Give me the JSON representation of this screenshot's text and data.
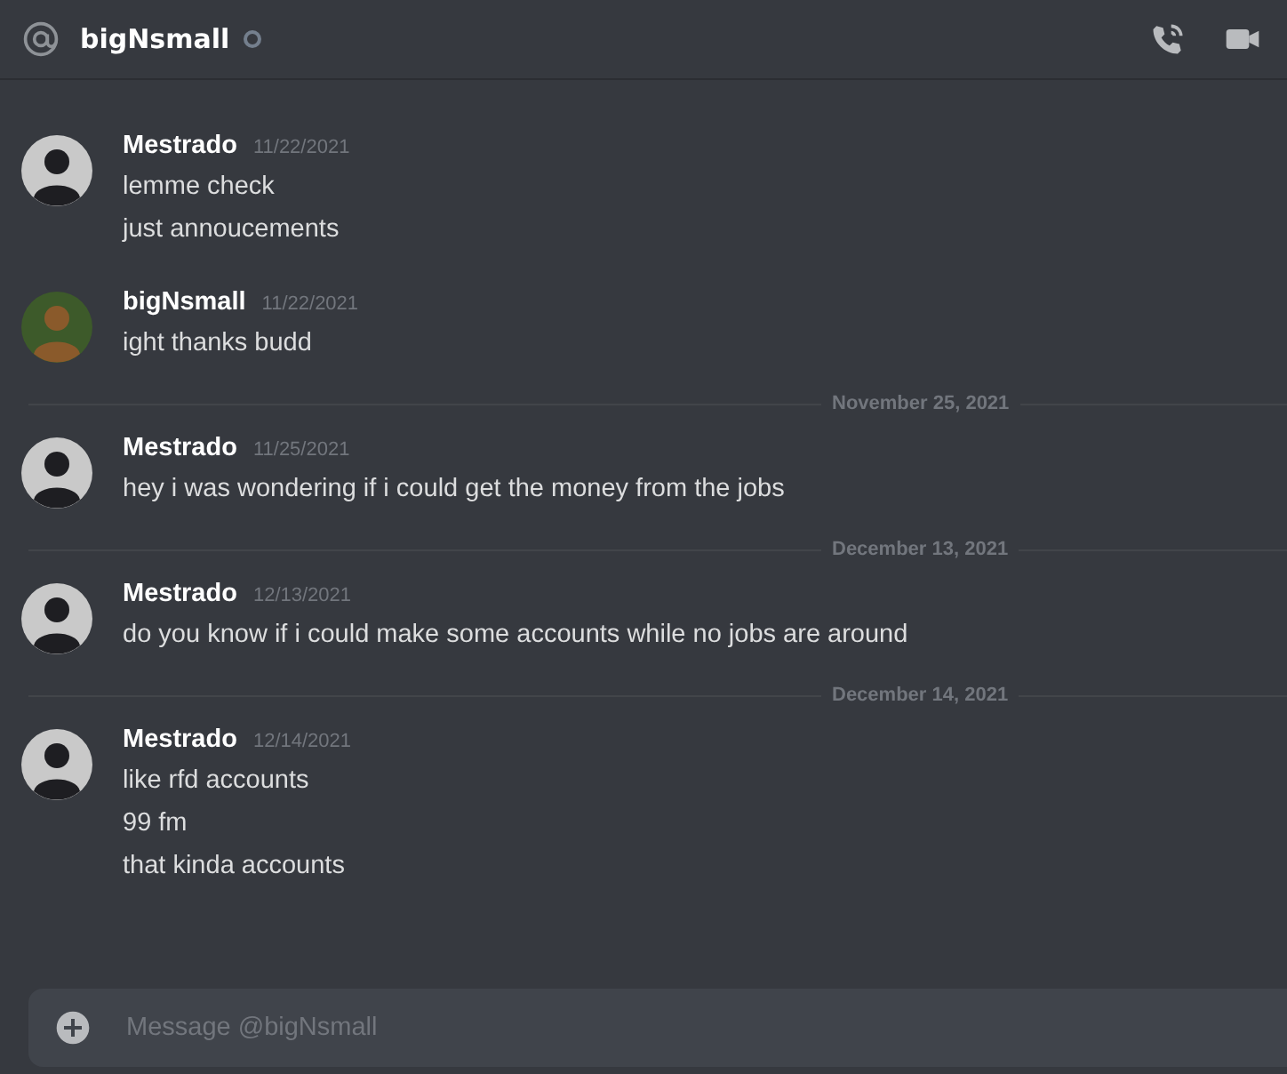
{
  "header": {
    "title": "bigNsmall",
    "online": false
  },
  "messages": [
    {
      "kind": "group",
      "author": "Mestrado",
      "color": "#c9c9c9",
      "time": "11/22/2021",
      "lines": [
        "lemme check",
        "just annoucements"
      ]
    },
    {
      "kind": "group",
      "author": "bigNsmall",
      "color": "#3d5a2a",
      "time": "11/22/2021",
      "lines": [
        "ight thanks budd"
      ]
    },
    {
      "kind": "divider",
      "date": "November 25, 2021"
    },
    {
      "kind": "group",
      "author": "Mestrado",
      "color": "#c9c9c9",
      "time": "11/25/2021",
      "lines": [
        "hey i was wondering if i could get the money from the jobs"
      ]
    },
    {
      "kind": "divider",
      "date": "December 13, 2021"
    },
    {
      "kind": "group",
      "author": "Mestrado",
      "color": "#c9c9c9",
      "time": "12/13/2021",
      "lines": [
        "do you know if i could make some accounts while no jobs are around"
      ]
    },
    {
      "kind": "divider",
      "date": "December 14, 2021"
    },
    {
      "kind": "group",
      "author": "Mestrado",
      "color": "#c9c9c9",
      "time": "12/14/2021",
      "lines": [
        "like rfd accounts",
        "99 fm",
        "that kinda accounts"
      ]
    }
  ],
  "composer": {
    "placeholder": "Message @bigNsmall"
  }
}
